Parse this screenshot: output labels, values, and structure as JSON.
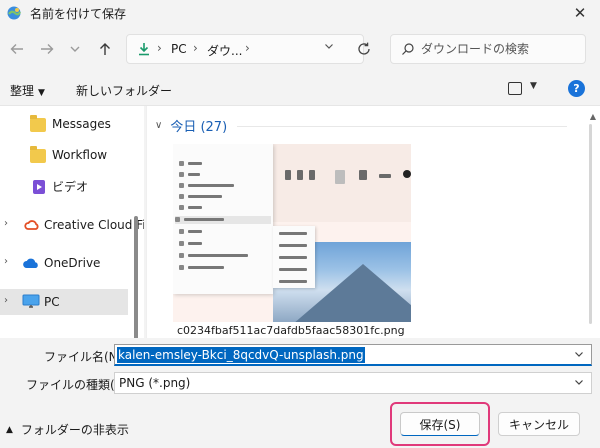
{
  "window": {
    "title": "名前を付けて保存",
    "close_glyph": "✕"
  },
  "nav": {
    "address": {
      "crumbs": [
        "PC",
        "ダウ..."
      ],
      "separator": "›"
    },
    "search": {
      "placeholder": "ダウンロードの検索"
    }
  },
  "toolbar": {
    "organize_label": "整理",
    "new_folder_label": "新しいフォルダー",
    "help_label": "?"
  },
  "sidebar": {
    "items": [
      {
        "label": "Messages",
        "icon": "folder-icon",
        "expandable": false
      },
      {
        "label": "Workflow",
        "icon": "folder-icon",
        "expandable": false
      },
      {
        "label": "ビデオ",
        "icon": "video-icon",
        "expandable": false
      },
      {
        "label": "Creative Cloud Fi",
        "icon": "creative-cloud-icon",
        "expandable": true
      },
      {
        "label": "OneDrive",
        "icon": "onedrive-icon",
        "expandable": true
      },
      {
        "label": "PC",
        "icon": "pc-icon",
        "expandable": true,
        "selected": true
      }
    ]
  },
  "file_list": {
    "group_header": "今日 (27)",
    "files": [
      {
        "name": "c0234fbaf511ac7dafdb5faac58301fc.png"
      }
    ]
  },
  "form": {
    "filename_label": "ファイル名(N):",
    "filename_value": "kalen-emsley-Bkci_8qcdvQ-unsplash.png",
    "filetype_label": "ファイルの種類(T):",
    "filetype_value": "PNG (*.png)"
  },
  "footer": {
    "hide_folders_label": "フォルダーの非表示",
    "save_label": "保存(S)",
    "cancel_label": "キャンセル"
  },
  "colors": {
    "accent": "#0067c0",
    "highlight_annotation": "#e0397a",
    "help": "#1a73d9"
  }
}
